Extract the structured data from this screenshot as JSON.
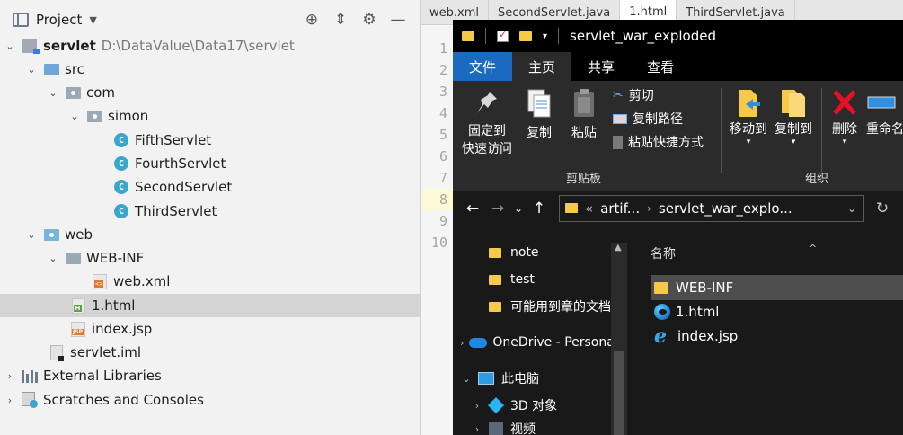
{
  "ide": {
    "panel_title": "Project",
    "tree": [
      {
        "label": "servlet",
        "path": "D:\\DataValue\\Data17\\servlet",
        "bold": true
      },
      {
        "label": "src"
      },
      {
        "label": "com"
      },
      {
        "label": "simon"
      },
      {
        "label": "FifthServlet"
      },
      {
        "label": "FourthServlet"
      },
      {
        "label": "SecondServlet"
      },
      {
        "label": "ThirdServlet"
      },
      {
        "label": "web"
      },
      {
        "label": "WEB-INF"
      },
      {
        "label": "web.xml"
      },
      {
        "label": "1.html",
        "selected": true
      },
      {
        "label": "index.jsp"
      },
      {
        "label": "servlet.iml"
      },
      {
        "label": "External Libraries"
      },
      {
        "label": "Scratches and Consoles"
      }
    ],
    "editor_tabs": [
      "web.xml",
      "SecondServlet.java",
      "1.html",
      "ThirdServlet.java"
    ],
    "line_numbers": [
      "1",
      "2",
      "3",
      "4",
      "5",
      "6",
      "7",
      "8",
      "9",
      "10"
    ],
    "current_line": "8"
  },
  "explorer": {
    "title": "servlet_war_exploded",
    "ribbon_tabs": [
      "文件",
      "主页",
      "共享",
      "查看"
    ],
    "clipboard": {
      "pin": "固定到\n快速访问",
      "copy": "复制",
      "paste": "粘贴",
      "cut": "剪切",
      "copy_path": "复制路径",
      "paste_shortcut": "粘贴快捷方式",
      "group": "剪贴板"
    },
    "organize": {
      "move_to": "移动到",
      "copy_to": "复制到",
      "delete": "删除",
      "rename": "重命名",
      "group": "组织"
    },
    "address": {
      "prefix": "«",
      "crumb1": "artif...",
      "crumb2": "servlet_war_explo..."
    },
    "nav_items": [
      {
        "label": "note",
        "type": "folder"
      },
      {
        "label": "test",
        "type": "folder"
      },
      {
        "label": "可能用到章的文档",
        "type": "folder"
      },
      {
        "label": "OneDrive - Personal",
        "type": "cloud"
      },
      {
        "label": "此电脑",
        "type": "pc"
      },
      {
        "label": "3D 对象",
        "type": "cube"
      },
      {
        "label": "视频",
        "type": "video"
      }
    ],
    "column_header": "名称",
    "files": [
      {
        "label": "WEB-INF",
        "type": "folder",
        "selected": true
      },
      {
        "label": "1.html",
        "type": "edge"
      },
      {
        "label": "index.jsp",
        "type": "ie"
      }
    ]
  }
}
